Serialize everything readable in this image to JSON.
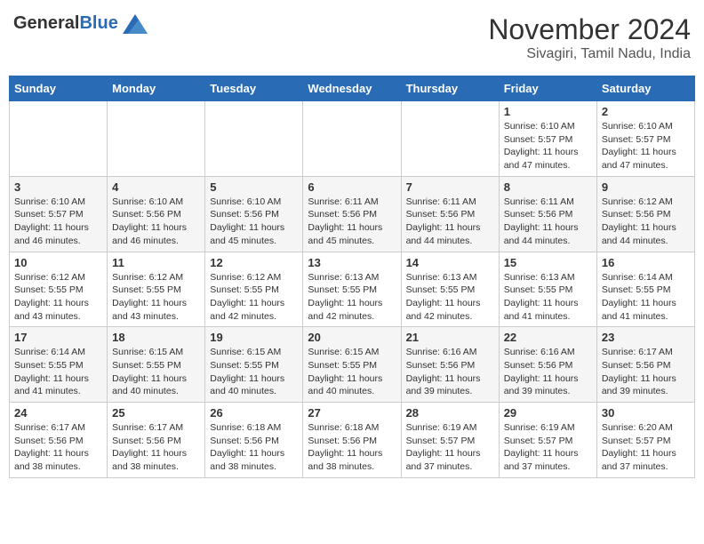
{
  "header": {
    "logo_general": "General",
    "logo_blue": "Blue",
    "month_title": "November 2024",
    "subtitle": "Sivagiri, Tamil Nadu, India"
  },
  "calendar": {
    "days_of_week": [
      "Sunday",
      "Monday",
      "Tuesday",
      "Wednesday",
      "Thursday",
      "Friday",
      "Saturday"
    ],
    "weeks": [
      [
        {
          "day": "",
          "info": ""
        },
        {
          "day": "",
          "info": ""
        },
        {
          "day": "",
          "info": ""
        },
        {
          "day": "",
          "info": ""
        },
        {
          "day": "",
          "info": ""
        },
        {
          "day": "1",
          "info": "Sunrise: 6:10 AM\nSunset: 5:57 PM\nDaylight: 11 hours\nand 47 minutes."
        },
        {
          "day": "2",
          "info": "Sunrise: 6:10 AM\nSunset: 5:57 PM\nDaylight: 11 hours\nand 47 minutes."
        }
      ],
      [
        {
          "day": "3",
          "info": "Sunrise: 6:10 AM\nSunset: 5:57 PM\nDaylight: 11 hours\nand 46 minutes."
        },
        {
          "day": "4",
          "info": "Sunrise: 6:10 AM\nSunset: 5:56 PM\nDaylight: 11 hours\nand 46 minutes."
        },
        {
          "day": "5",
          "info": "Sunrise: 6:10 AM\nSunset: 5:56 PM\nDaylight: 11 hours\nand 45 minutes."
        },
        {
          "day": "6",
          "info": "Sunrise: 6:11 AM\nSunset: 5:56 PM\nDaylight: 11 hours\nand 45 minutes."
        },
        {
          "day": "7",
          "info": "Sunrise: 6:11 AM\nSunset: 5:56 PM\nDaylight: 11 hours\nand 44 minutes."
        },
        {
          "day": "8",
          "info": "Sunrise: 6:11 AM\nSunset: 5:56 PM\nDaylight: 11 hours\nand 44 minutes."
        },
        {
          "day": "9",
          "info": "Sunrise: 6:12 AM\nSunset: 5:56 PM\nDaylight: 11 hours\nand 44 minutes."
        }
      ],
      [
        {
          "day": "10",
          "info": "Sunrise: 6:12 AM\nSunset: 5:55 PM\nDaylight: 11 hours\nand 43 minutes."
        },
        {
          "day": "11",
          "info": "Sunrise: 6:12 AM\nSunset: 5:55 PM\nDaylight: 11 hours\nand 43 minutes."
        },
        {
          "day": "12",
          "info": "Sunrise: 6:12 AM\nSunset: 5:55 PM\nDaylight: 11 hours\nand 42 minutes."
        },
        {
          "day": "13",
          "info": "Sunrise: 6:13 AM\nSunset: 5:55 PM\nDaylight: 11 hours\nand 42 minutes."
        },
        {
          "day": "14",
          "info": "Sunrise: 6:13 AM\nSunset: 5:55 PM\nDaylight: 11 hours\nand 42 minutes."
        },
        {
          "day": "15",
          "info": "Sunrise: 6:13 AM\nSunset: 5:55 PM\nDaylight: 11 hours\nand 41 minutes."
        },
        {
          "day": "16",
          "info": "Sunrise: 6:14 AM\nSunset: 5:55 PM\nDaylight: 11 hours\nand 41 minutes."
        }
      ],
      [
        {
          "day": "17",
          "info": "Sunrise: 6:14 AM\nSunset: 5:55 PM\nDaylight: 11 hours\nand 41 minutes."
        },
        {
          "day": "18",
          "info": "Sunrise: 6:15 AM\nSunset: 5:55 PM\nDaylight: 11 hours\nand 40 minutes."
        },
        {
          "day": "19",
          "info": "Sunrise: 6:15 AM\nSunset: 5:55 PM\nDaylight: 11 hours\nand 40 minutes."
        },
        {
          "day": "20",
          "info": "Sunrise: 6:15 AM\nSunset: 5:55 PM\nDaylight: 11 hours\nand 40 minutes."
        },
        {
          "day": "21",
          "info": "Sunrise: 6:16 AM\nSunset: 5:56 PM\nDaylight: 11 hours\nand 39 minutes."
        },
        {
          "day": "22",
          "info": "Sunrise: 6:16 AM\nSunset: 5:56 PM\nDaylight: 11 hours\nand 39 minutes."
        },
        {
          "day": "23",
          "info": "Sunrise: 6:17 AM\nSunset: 5:56 PM\nDaylight: 11 hours\nand 39 minutes."
        }
      ],
      [
        {
          "day": "24",
          "info": "Sunrise: 6:17 AM\nSunset: 5:56 PM\nDaylight: 11 hours\nand 38 minutes."
        },
        {
          "day": "25",
          "info": "Sunrise: 6:17 AM\nSunset: 5:56 PM\nDaylight: 11 hours\nand 38 minutes."
        },
        {
          "day": "26",
          "info": "Sunrise: 6:18 AM\nSunset: 5:56 PM\nDaylight: 11 hours\nand 38 minutes."
        },
        {
          "day": "27",
          "info": "Sunrise: 6:18 AM\nSunset: 5:56 PM\nDaylight: 11 hours\nand 38 minutes."
        },
        {
          "day": "28",
          "info": "Sunrise: 6:19 AM\nSunset: 5:57 PM\nDaylight: 11 hours\nand 37 minutes."
        },
        {
          "day": "29",
          "info": "Sunrise: 6:19 AM\nSunset: 5:57 PM\nDaylight: 11 hours\nand 37 minutes."
        },
        {
          "day": "30",
          "info": "Sunrise: 6:20 AM\nSunset: 5:57 PM\nDaylight: 11 hours\nand 37 minutes."
        }
      ]
    ]
  }
}
